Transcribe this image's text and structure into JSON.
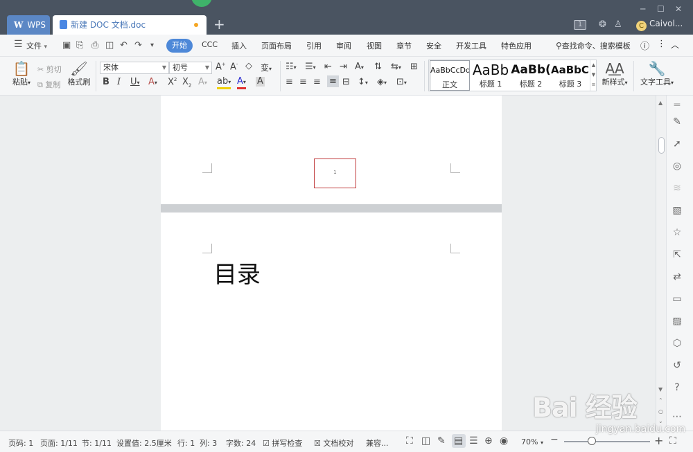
{
  "titlebar": {
    "app_tab": "WPS",
    "doc_tab": "新建 DOC 文档.doc",
    "badge": "1",
    "user_name": "Caivol...",
    "user_initial": "C"
  },
  "menu": {
    "file": "文件",
    "items": [
      "开始",
      "CCC",
      "插入",
      "页面布局",
      "引用",
      "审阅",
      "视图",
      "章节",
      "安全",
      "开发工具",
      "特色应用"
    ],
    "search": "查找命令、搜索模板"
  },
  "ribbon": {
    "paste": "粘贴",
    "cut": "剪切",
    "copy": "复制",
    "format_painter": "格式刷",
    "font_name": "宋体",
    "font_size": "初号",
    "styles": [
      {
        "preview": "AaBbCcDd",
        "name": "正文"
      },
      {
        "preview": "AaBb",
        "name": "标题 1"
      },
      {
        "preview": "AaBb(",
        "name": "标题 2"
      },
      {
        "preview": "AaBbC(",
        "name": "标题 3"
      }
    ],
    "new_style": "新样式",
    "text_tools": "文字工具"
  },
  "document": {
    "footer_page_number": "1",
    "heading": "目录"
  },
  "status": {
    "page_code": "页码: 1",
    "page": "页面: 1/11",
    "section": "节: 1/11",
    "setting": "设置值: 2.5厘米",
    "row": "行: 1",
    "col": "列: 3",
    "word_count": "字数: 24",
    "spell_check": "拼写检查",
    "doc_proof": "文档校对",
    "compat": "兼容...",
    "zoom": "70%"
  },
  "watermark": {
    "line1": "Bai 经验",
    "line2": "jingyan.baidu.com"
  },
  "icons": {
    "menu": "hamburger-icon",
    "search": "search-icon",
    "help": "help-icon"
  }
}
